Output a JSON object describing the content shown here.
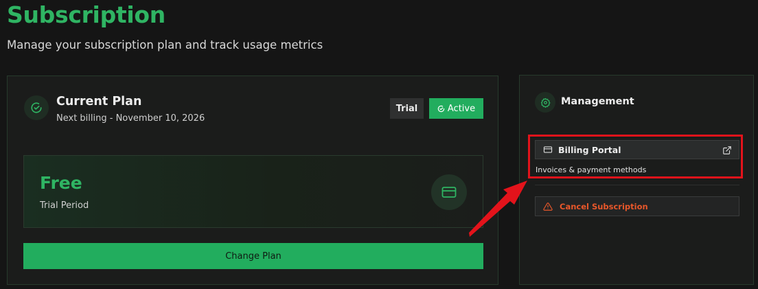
{
  "header": {
    "title": "Subscription",
    "subtitle": "Manage your subscription plan and track usage metrics"
  },
  "plan_card": {
    "title": "Current Plan",
    "billing": "Next billing - November 10, 2026",
    "badge_trial": "Trial",
    "badge_active": "Active",
    "plan_name": "Free",
    "plan_period": "Trial Period",
    "change_button": "Change Plan",
    "icons": [
      "check-circle-icon",
      "check-circle-small-icon",
      "credit-card-icon"
    ]
  },
  "management": {
    "title": "Management",
    "billing_portal_label": "Billing Portal",
    "billing_portal_desc": "Invoices & payment methods",
    "cancel_label": "Cancel Subscription",
    "icons": [
      "gear-icon",
      "credit-card-icon",
      "external-link-icon",
      "warning-icon"
    ]
  },
  "colors": {
    "accent": "#22ad5e",
    "title_green": "#2fb463",
    "danger": "#e8572a",
    "annotation_red": "#e3131b",
    "background": "#151515"
  }
}
